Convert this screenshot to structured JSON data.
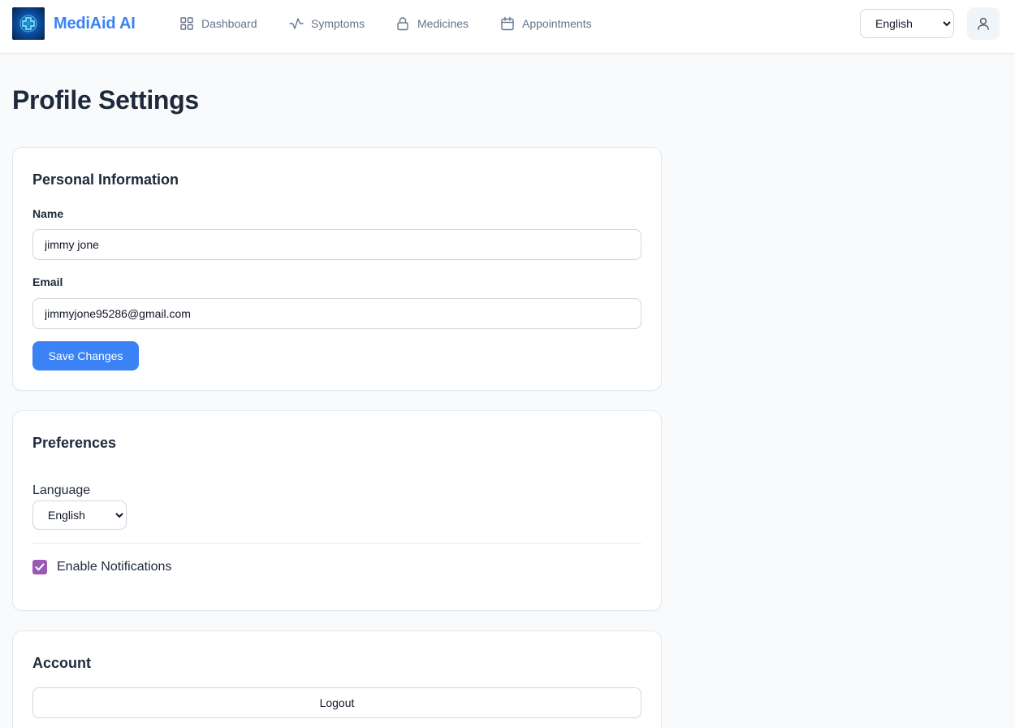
{
  "header": {
    "brand": "MediAid AI",
    "nav": [
      {
        "label": "Dashboard",
        "icon": "grid-icon"
      },
      {
        "label": "Symptoms",
        "icon": "activity-icon"
      },
      {
        "label": "Medicines",
        "icon": "lock-icon"
      },
      {
        "label": "Appointments",
        "icon": "calendar-icon"
      }
    ],
    "language_selected": "English",
    "profile_icon": "user-icon"
  },
  "page": {
    "title": "Profile Settings"
  },
  "personal_info": {
    "title": "Personal Information",
    "name_label": "Name",
    "name_value": "jimmy jone",
    "email_label": "Email",
    "email_value": "jimmyjone95286@gmail.com",
    "save_label": "Save Changes"
  },
  "preferences": {
    "title": "Preferences",
    "language_label": "Language",
    "language_selected": "English",
    "notifications_label": "Enable Notifications",
    "notifications_enabled": true
  },
  "account": {
    "title": "Account",
    "logout_label": "Logout"
  },
  "colors": {
    "brand": "#3b82f6",
    "checkbox_accent": "#9b59b6"
  }
}
